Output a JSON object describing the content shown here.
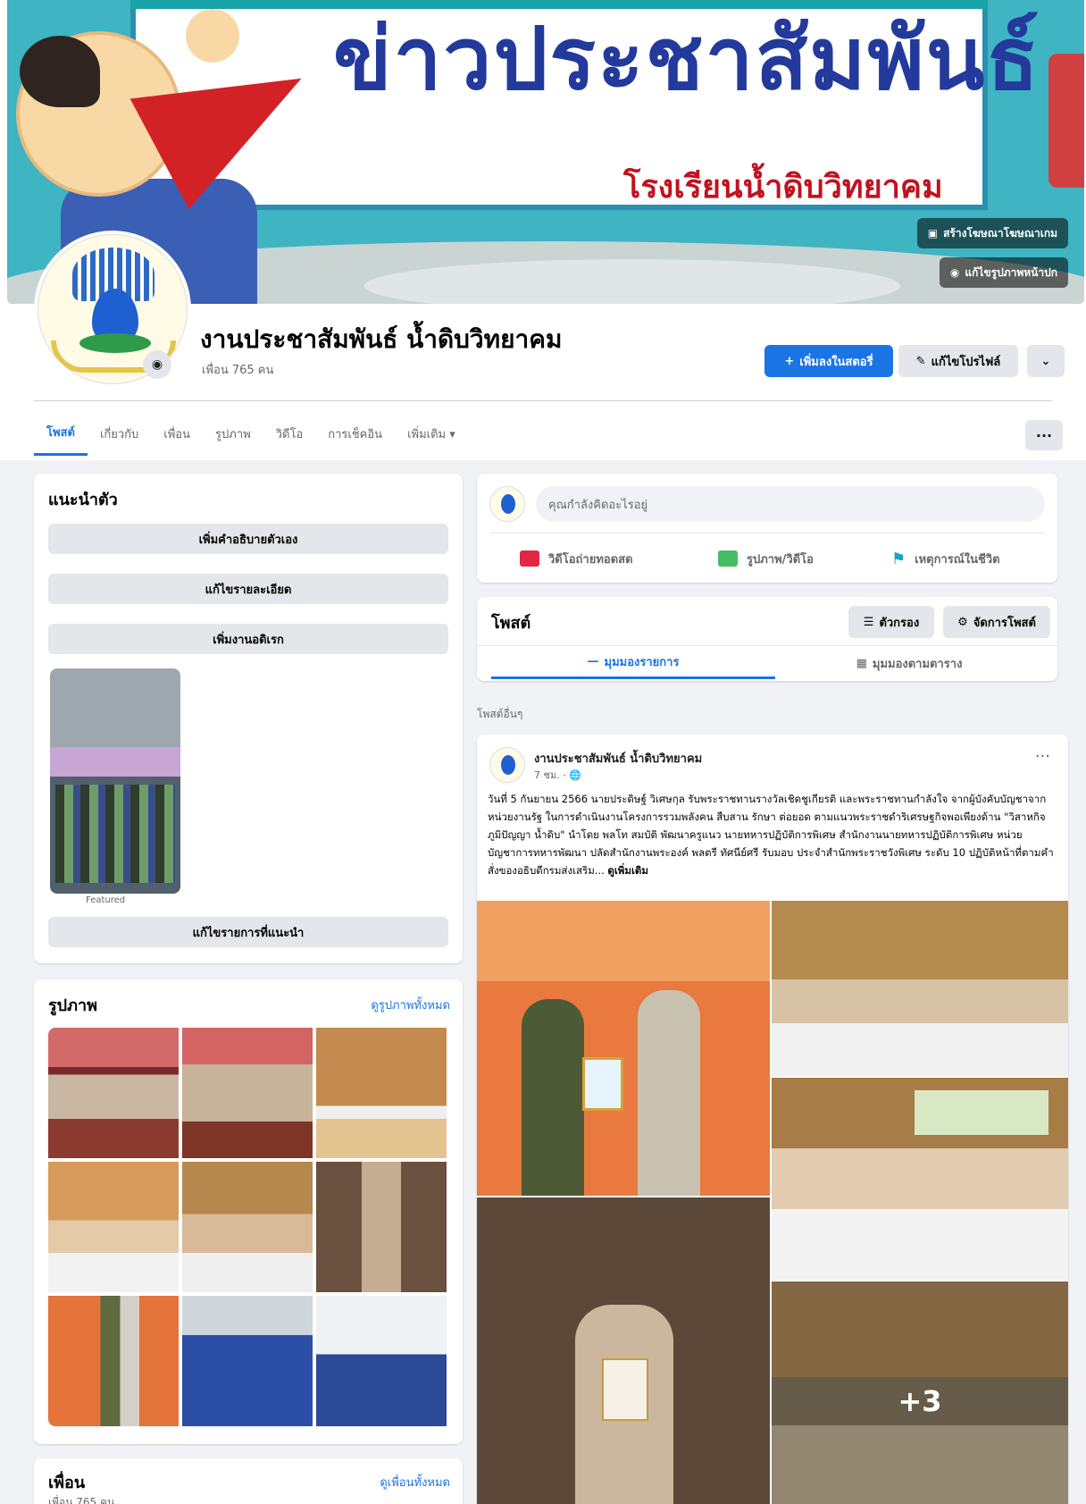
{
  "cover": {
    "title": "ข่าวประชาสัมพันธ์",
    "subtitle": "โรงเรียนน้ำดิบวิทยาคม",
    "btn_create": "สร้างโฆษณาโฆษณาเกม",
    "btn_edit_cover": "แก้ไขรูปภาพหน้าปก"
  },
  "page": {
    "name": "งานประชาสัมพันธ์ น้ำดิบวิทยาคม",
    "followers": "เพื่อน 765 คน",
    "add_story": "เพิ่มลงในสตอรี่",
    "edit_profile": "แก้ไขโปรไฟล์",
    "more": "⌄"
  },
  "tabs": [
    "โพสต์",
    "เกี่ยวกับ",
    "เพื่อน",
    "รูปภาพ",
    "วิดีโอ",
    "การเช็คอิน",
    "เพิ่มเติม ▾"
  ],
  "intro": {
    "title": "แนะนำตัว",
    "buttons": [
      "เพิ่มคำอธิบายตัวเอง",
      "แก้ไขรายละเอียด",
      "เพิ่มงานอดิเรก"
    ],
    "featured_label": "Featured",
    "edit_featured": "แก้ไขรายการที่แนะนำ"
  },
  "photos": {
    "title": "รูปภาพ",
    "see_all": "ดูรูปภาพทั้งหมด"
  },
  "friends": {
    "title": "เพื่อน",
    "count": "เพื่อน 765 คน",
    "see_all": "ดูเพื่อนทั้งหมด"
  },
  "composer": {
    "placeholder": "คุณกำลังคิดอะไรอยู่",
    "live": "วิดีโอถ่ายทอดสด",
    "photo": "รูปภาพ/วิดีโอ",
    "life_event": "เหตุการณ์ในชีวิต"
  },
  "posts_bar": {
    "title": "โพสต์",
    "filter": "ตัวกรอง",
    "manage": "จัดการโพสต์",
    "list_view": "มุมมองรายการ",
    "grid_view": "มุมมองตามตาราง"
  },
  "other_posts_label": "โพสต์อื่นๆ",
  "post": {
    "author": "งานประชาสัมพันธ์ น้ำดิบวิทยาคม",
    "time": "7 ชม. · 🌐",
    "text": "วันที่ 5 กันยายน 2566 นายประดิษฐ์ วิเศษกุล รับพระราชทานรางวัลเชิดชูเกียรติ และพระราชทานกำลังใจ จากผู้บังคับบัญชาจากหน่วยงานรัฐ ในการดำเนินงานโครงการรวมพลังคน สืบสาน รักษา ต่อยอด ตามแนวพระราชดำริเศรษฐกิจพอเพียงด้าน \"วิสาหกิจ ภูมิปัญญา น้ำดิบ\" นำโดย พลโท สมบัติ พัฒนาครูแนว นายทหารปฏิบัติการพิเศษ สำนักงานนายทหารปฏิบัติการพิเศษ หน่วยบัญชาการทหารพัฒนา ปลัดสำนักงานพระองค์ พลตรี ทัศนีย์ศรี รับมอบ ประจำสำนักพระราชวังพิเศษ ระดับ 10 ปฏิบัติหน้าที่ตามคำสั่งของอธิบดีกรมส่งเสริม...",
    "see_more": "ดูเพิ่มเติม",
    "more_count": "+3"
  },
  "icons": {
    "camera": "camera-icon",
    "live": "live-video-icon",
    "photo": "photo-icon",
    "flag": "flag-icon"
  },
  "colors": {
    "accent": "#1b74e4",
    "live_red": "#e42645",
    "photo_green": "#45bd62",
    "flag_teal": "#1aa3c2"
  }
}
